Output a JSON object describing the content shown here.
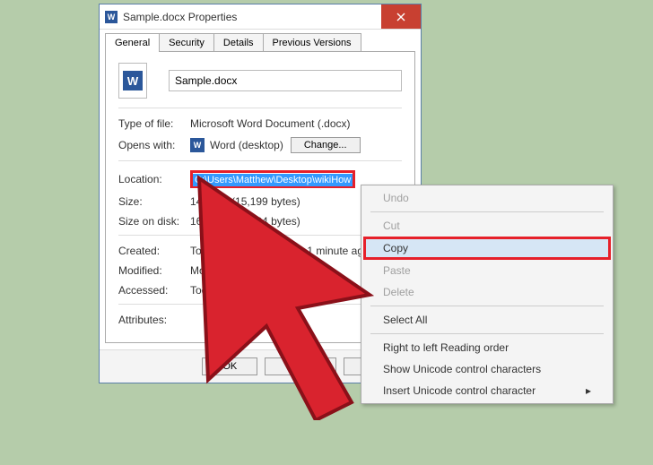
{
  "title": "Sample.docx Properties",
  "tabs": [
    "General",
    "Security",
    "Details",
    "Previous Versions"
  ],
  "filename": "Sample.docx",
  "typeOfFile": {
    "label": "Type of file:",
    "value": "Microsoft Word Document (.docx)"
  },
  "opensWith": {
    "label": "Opens with:",
    "value": "Word (desktop)",
    "change": "Change..."
  },
  "location": {
    "label": "Location:",
    "value": "C:\\Users\\Matthew\\Desktop\\wikiHow"
  },
  "size": {
    "label": "Size:",
    "value": "14.8 KB (15,199 bytes)"
  },
  "sizeOnDisk": {
    "label": "Size on disk:",
    "value": "16.0 KB (16,384 bytes)"
  },
  "created": {
    "label": "Created:",
    "value": "Today, August 11, 2016, 1 minute ago"
  },
  "modified": {
    "label": "Modified:",
    "value": "Monday, December"
  },
  "accessed": {
    "label": "Accessed:",
    "value": "Today, August"
  },
  "attributes": {
    "label": "Attributes:"
  },
  "buttons": {
    "ok": "OK",
    "cancel": "Cancel",
    "apply": "Apply"
  },
  "menu": {
    "undo": "Undo",
    "cut": "Cut",
    "copy": "Copy",
    "paste": "Paste",
    "delete": "Delete",
    "selectAll": "Select All",
    "rtl": "Right to left Reading order",
    "showUni": "Show Unicode control characters",
    "insertUni": "Insert Unicode control character"
  }
}
